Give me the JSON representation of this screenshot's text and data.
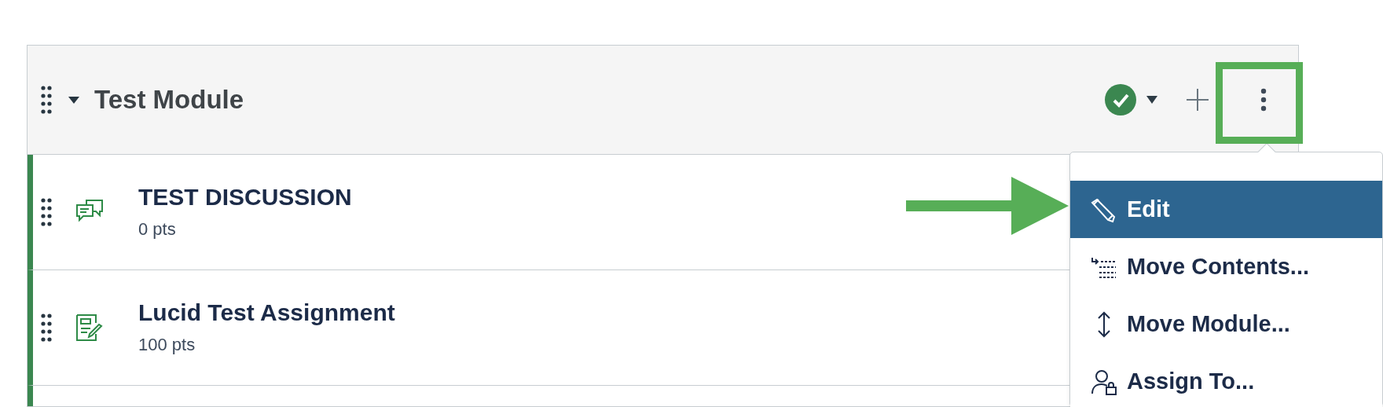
{
  "module": {
    "title": "Test Module",
    "expanded": true,
    "published": true,
    "items": [
      {
        "kind": "discussion",
        "title": "TEST DISCUSSION",
        "points": "0 pts"
      },
      {
        "kind": "assignment",
        "title": "Lucid Test Assignment",
        "points": "100 pts"
      }
    ]
  },
  "menu": {
    "items": [
      {
        "kind": "edit",
        "label": "Edit",
        "selected": true
      },
      {
        "kind": "move-contents",
        "label": "Move Contents...",
        "selected": false
      },
      {
        "kind": "move-module",
        "label": "Move Module...",
        "selected": false
      },
      {
        "kind": "assign",
        "label": "Assign To...",
        "selected": false
      }
    ]
  }
}
